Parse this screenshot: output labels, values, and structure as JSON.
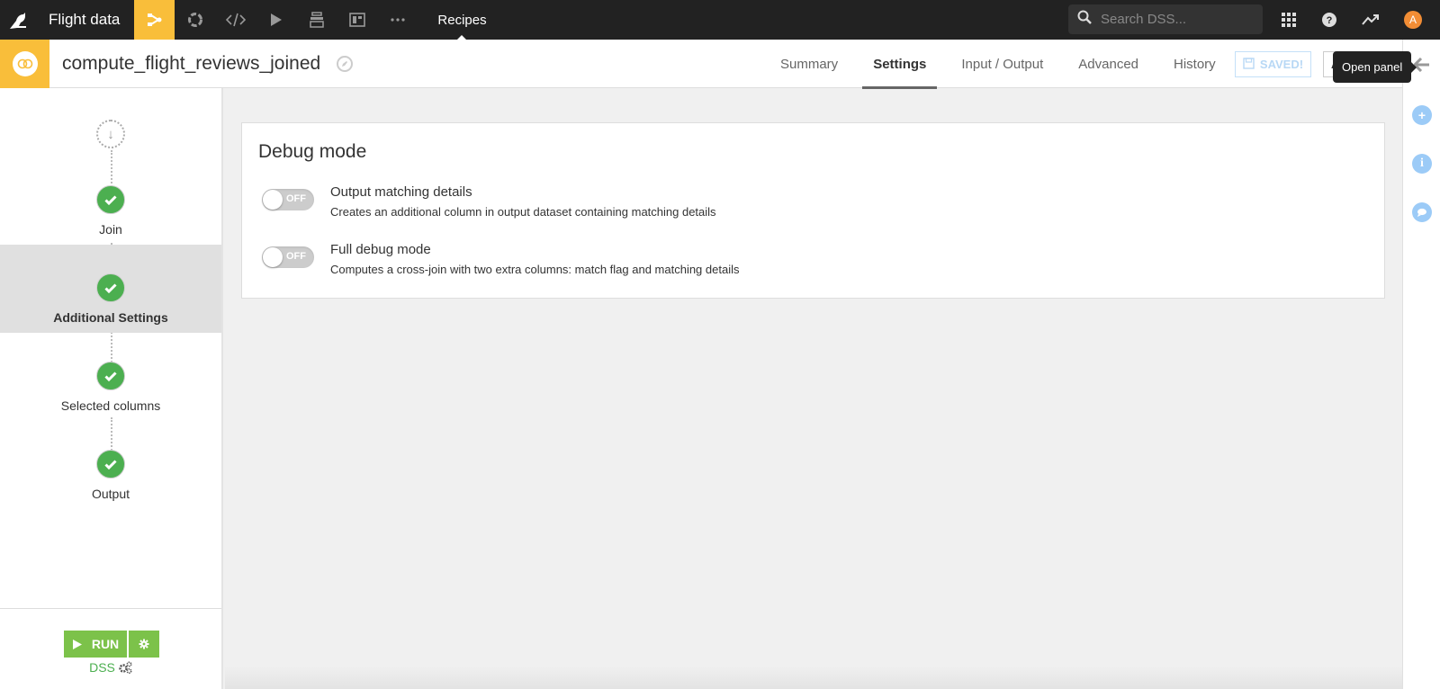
{
  "topbar": {
    "project_name": "Flight data",
    "nav_icons": [
      "flow-icon",
      "jobs-icon",
      "code-icon",
      "run-icon",
      "datasets-icon",
      "dashboard-icon",
      "more-icon"
    ],
    "active_section": "Recipes",
    "search_placeholder": "Search DSS...",
    "avatar_initial": "A",
    "accent_color": "#f9be3a"
  },
  "header": {
    "recipe_name": "compute_flight_reviews_joined",
    "tabs": [
      {
        "label": "Summary",
        "active": false
      },
      {
        "label": "Settings",
        "active": true
      },
      {
        "label": "Input / Output",
        "active": false
      },
      {
        "label": "Advanced",
        "active": false
      },
      {
        "label": "History",
        "active": false
      }
    ],
    "saved_label": "SAVED!",
    "actions_label": "ACTIONS",
    "tooltip": "Open panel"
  },
  "sidebar": {
    "steps": [
      {
        "label": "Join",
        "status": "complete",
        "active": false
      },
      {
        "label": "Additional Settings",
        "status": "complete",
        "active": true
      },
      {
        "label": "Selected columns",
        "status": "complete",
        "active": false
      },
      {
        "label": "Output",
        "status": "complete",
        "active": false
      }
    ],
    "run_label": "RUN",
    "engine_label": "DSS"
  },
  "main": {
    "section_title": "Debug mode",
    "options": [
      {
        "title": "Output matching details",
        "description": "Creates an additional column in output dataset containing matching details",
        "state": "OFF"
      },
      {
        "title": "Full debug mode",
        "description": "Computes a cross-join with two extra columns: match flag and matching details",
        "state": "OFF"
      }
    ]
  },
  "right_rail": {
    "buttons": [
      "add-icon",
      "info-icon",
      "discussion-icon"
    ]
  }
}
